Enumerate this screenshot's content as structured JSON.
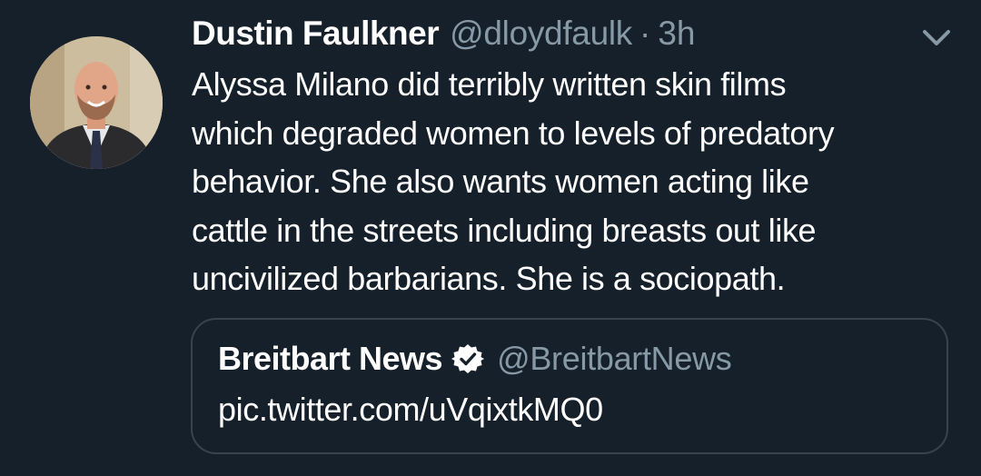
{
  "tweet": {
    "author": {
      "display_name": "Dustin Faulkner",
      "handle": "@dloydfaulk",
      "separator": "·",
      "time": "3h"
    },
    "menu_icon": "chevron-down-icon",
    "text_lines": [
      "Alyssa Milano did terribly written skin films",
      "which degraded women to levels of predatory",
      "behavior. She also wants women acting like",
      "cattle in the streets including breasts out like",
      "uncivilized barbarians. She is a sociopath."
    ],
    "quoted": {
      "display_name": "Breitbart News",
      "verified_icon": "verified-badge-icon",
      "handle": "@BreitbartNews",
      "text": "pic.twitter.com/uVqixtkMQ0"
    }
  },
  "colors": {
    "background": "#15202b",
    "primary_text": "#ffffff",
    "secondary_text": "#8899a6",
    "border": "#38444d"
  }
}
